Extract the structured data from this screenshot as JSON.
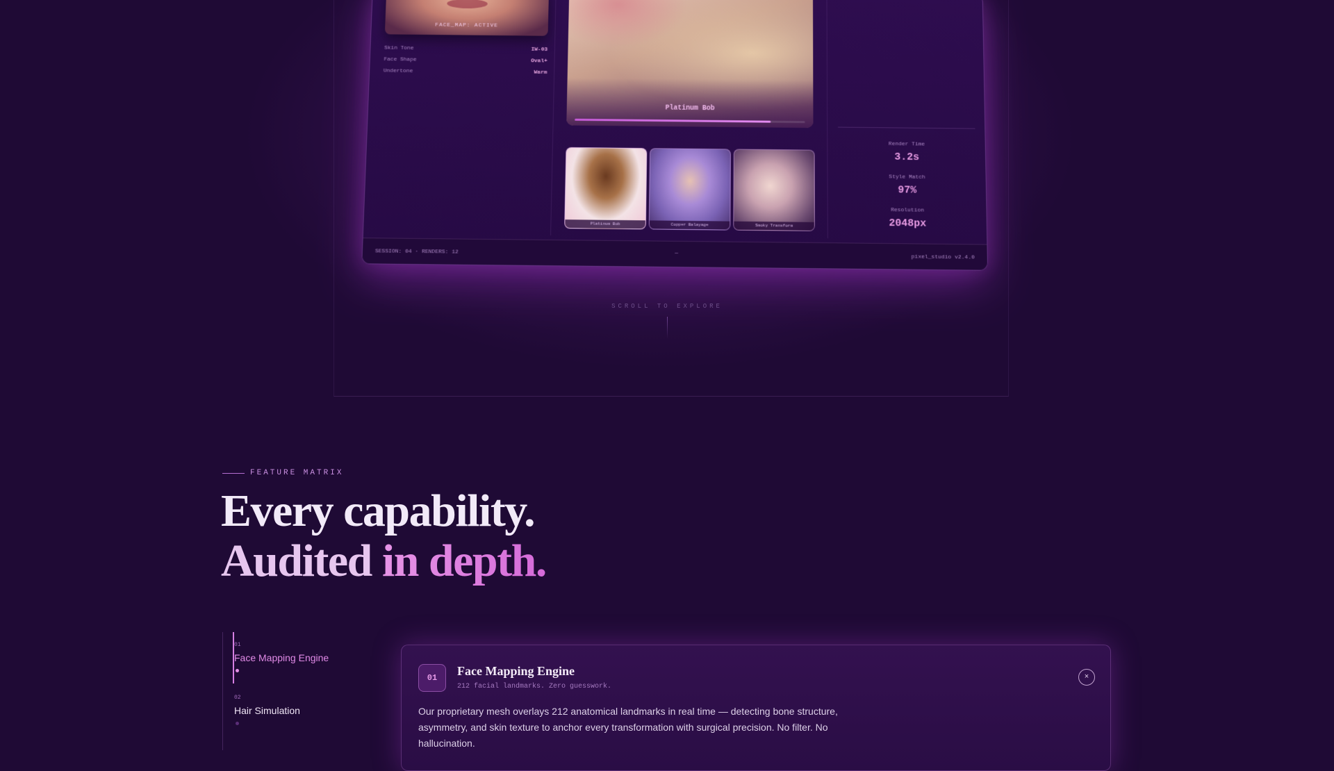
{
  "mockup": {
    "face_label": "FACE_MAP: ACTIVE",
    "specs": [
      {
        "key": "Skin Tone",
        "value": "IW-03"
      },
      {
        "key": "Face Shape",
        "value": "Oval+"
      },
      {
        "key": "Undertone",
        "value": "Warm"
      }
    ],
    "main_label": "Platinum Bob",
    "progress": 0.85,
    "thumbs": [
      {
        "caption": "Platinum Bob"
      },
      {
        "caption": "Copper Balayage"
      },
      {
        "caption": "Smoky Transform"
      }
    ],
    "stats": [
      {
        "key": "Render Time",
        "value": "3.2s"
      },
      {
        "key": "Style Match",
        "value": "97%"
      },
      {
        "key": "Resolution",
        "value": "2048px"
      }
    ],
    "footer": {
      "left": "SESSION: 04 · RENDERS: 12",
      "center": "—",
      "right": "pixel_studio v2.4.0"
    }
  },
  "scroll_hint": "SCROLL TO EXPLORE",
  "section": {
    "eyebrow": "FEATURE MATRIX",
    "heading_line1": "Every capability.",
    "heading_line2a": "Audited ",
    "heading_line2b": "in depth."
  },
  "features": [
    {
      "num": "01",
      "name": "Face Mapping Engine",
      "active": true
    },
    {
      "num": "02",
      "name": "Hair Simulation",
      "active": false
    }
  ],
  "detail": {
    "badge": "01",
    "title": "Face Mapping Engine",
    "subtitle": "212 facial landmarks. Zero guesswork.",
    "close": "×",
    "body": "Our proprietary mesh overlays 212 anatomical landmarks in real time — detecting bone structure, asymmetry, and skin texture to anchor every transformation with surgical precision. No filter. No hallucination."
  }
}
